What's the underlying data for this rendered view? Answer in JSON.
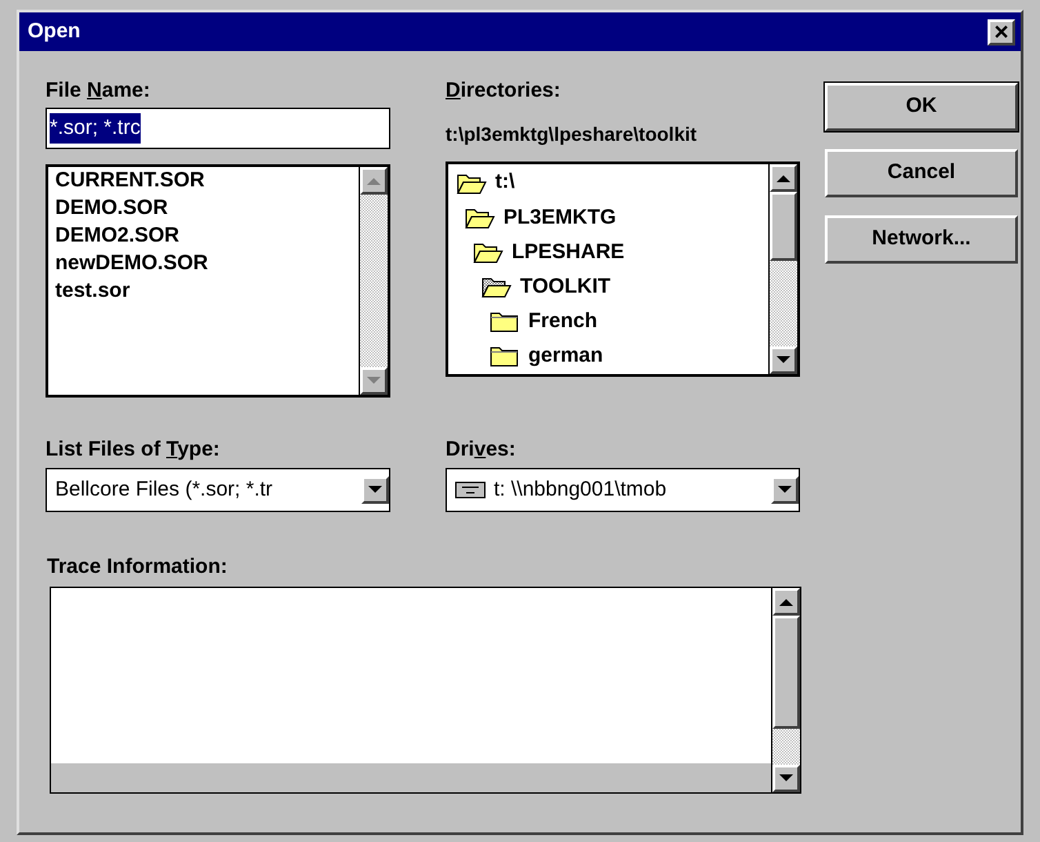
{
  "window": {
    "title": "Open",
    "close": "×"
  },
  "file_name": {
    "label": {
      "pre": "File ",
      "key": "N",
      "post": "ame:"
    },
    "value": "*.sor; *.trc",
    "highlighted": true
  },
  "files": [
    "CURRENT.SOR",
    "DEMO.SOR",
    "DEMO2.SOR",
    "newDEMO.SOR",
    "test.sor"
  ],
  "directories": {
    "label": {
      "key": "D",
      "post": "irectories:"
    },
    "path": "t:\\pl3emktg\\lpeshare\\toolkit",
    "tree": [
      {
        "name": "t:\\",
        "open": true,
        "current": false,
        "children": [
          {
            "name": "PL3EMKTG",
            "open": true,
            "current": false,
            "children": [
              {
                "name": "LPESHARE",
                "open": true,
                "current": false,
                "children": [
                  {
                    "name": "TOOLKIT",
                    "open": true,
                    "current": true,
                    "children": [
                      {
                        "name": "French",
                        "open": false,
                        "current": false
                      },
                      {
                        "name": "german",
                        "open": false,
                        "current": false
                      }
                    ]
                  }
                ]
              }
            ]
          }
        ]
      }
    ]
  },
  "buttons": [
    "OK",
    "Cancel",
    "Network..."
  ],
  "file_type": {
    "label": {
      "pre": "List Files of ",
      "key": "T",
      "post": "ype:"
    },
    "value": "Bellcore Files (*.sor; *.tr"
  },
  "drives": {
    "label": {
      "pre": "Dri",
      "key": "v",
      "post": "es:"
    },
    "value": "t: \\\\nbbng001\\tmob"
  },
  "trace": {
    "label": {
      "pre": "Trace Information:"
    }
  }
}
